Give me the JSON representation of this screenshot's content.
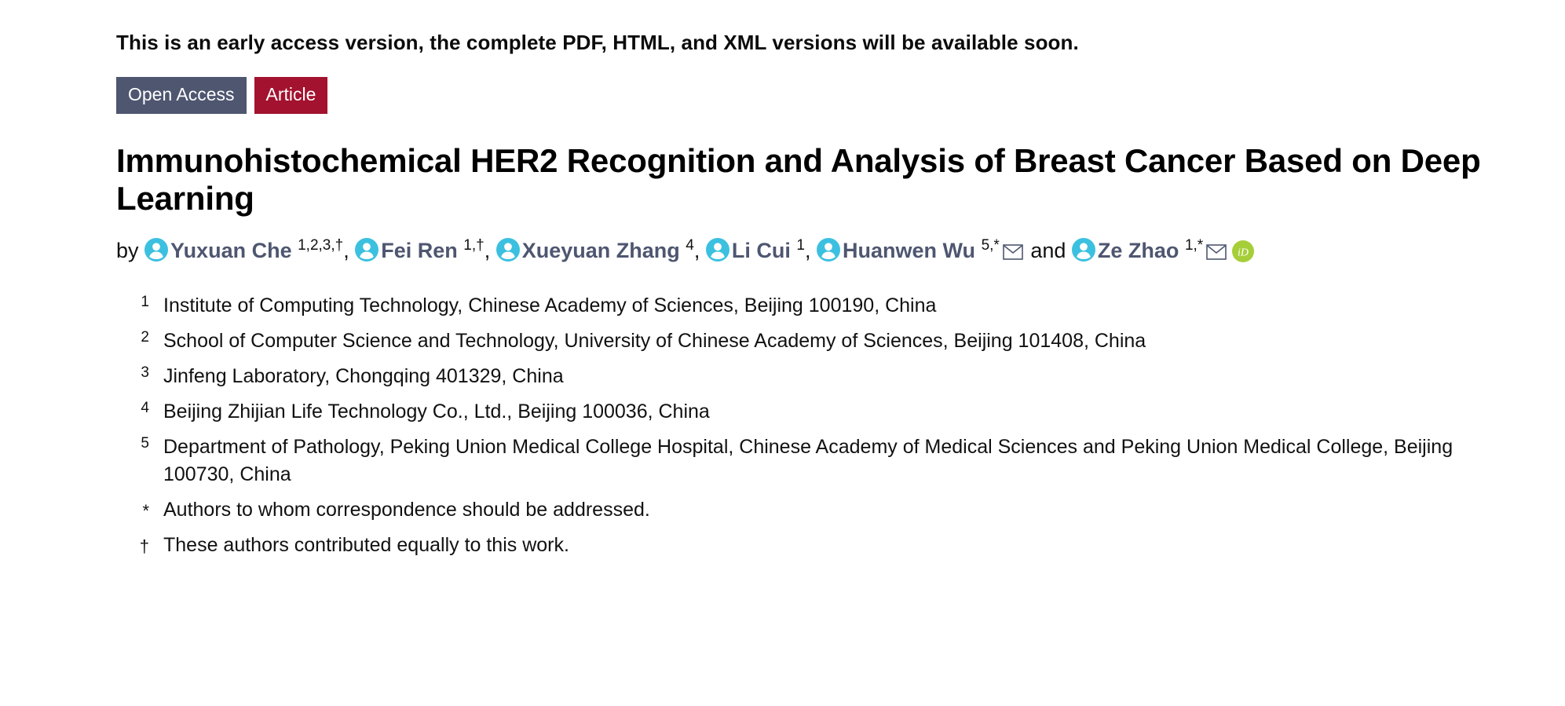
{
  "notice": "This is an early access version, the complete PDF, HTML, and XML versions will be available soon.",
  "badges": {
    "open_access": "Open Access",
    "article": "Article",
    "open_access_color": "#4e5670",
    "article_color": "#a3122e"
  },
  "title": "Immunohistochemical HER2 Recognition and Analysis of Breast Cancer Based on Deep Learning",
  "byline": {
    "prefix": "by",
    "conjunction": "and",
    "author_color": "#4e5670",
    "person_icon_color": "#3cc0e0",
    "orcid_color": "#a6ce39",
    "authors": [
      {
        "name": "Yuxuan Che",
        "sup": "1,2,3,†",
        "icon": "person-icon",
        "mail": false,
        "orcid": false,
        "trailing": ","
      },
      {
        "name": "Fei Ren",
        "sup": "1,†",
        "icon": "person-icon",
        "mail": false,
        "orcid": false,
        "trailing": ","
      },
      {
        "name": "Xueyuan Zhang",
        "sup": "4",
        "icon": "person-icon",
        "mail": false,
        "orcid": false,
        "trailing": ","
      },
      {
        "name": "Li Cui",
        "sup": "1",
        "icon": "person-icon",
        "mail": false,
        "orcid": false,
        "trailing": ","
      },
      {
        "name": "Huanwen Wu",
        "sup": "5,*",
        "icon": "person-icon",
        "mail": true,
        "orcid": false,
        "trailing": ""
      },
      {
        "name": "Ze Zhao",
        "sup": "1,*",
        "icon": "person-icon",
        "mail": true,
        "orcid": true,
        "trailing": ""
      }
    ]
  },
  "affiliations": [
    {
      "marker": "1",
      "text": "Institute of Computing Technology, Chinese Academy of Sciences, Beijing 100190, China"
    },
    {
      "marker": "2",
      "text": "School of Computer Science and Technology, University of Chinese Academy of Sciences, Beijing 101408, China"
    },
    {
      "marker": "3",
      "text": "Jinfeng Laboratory, Chongqing 401329, China"
    },
    {
      "marker": "4",
      "text": "Beijing Zhijian Life Technology Co., Ltd., Beijing 100036, China"
    },
    {
      "marker": "5",
      "text": "Department of Pathology, Peking Union Medical College Hospital, Chinese Academy of Medical Sciences and Peking Union Medical College, Beijing 100730, China"
    }
  ],
  "footnotes": [
    {
      "marker": "*",
      "text": "Authors to whom correspondence should be addressed."
    },
    {
      "marker": "†",
      "text": "These authors contributed equally to this work."
    }
  ]
}
